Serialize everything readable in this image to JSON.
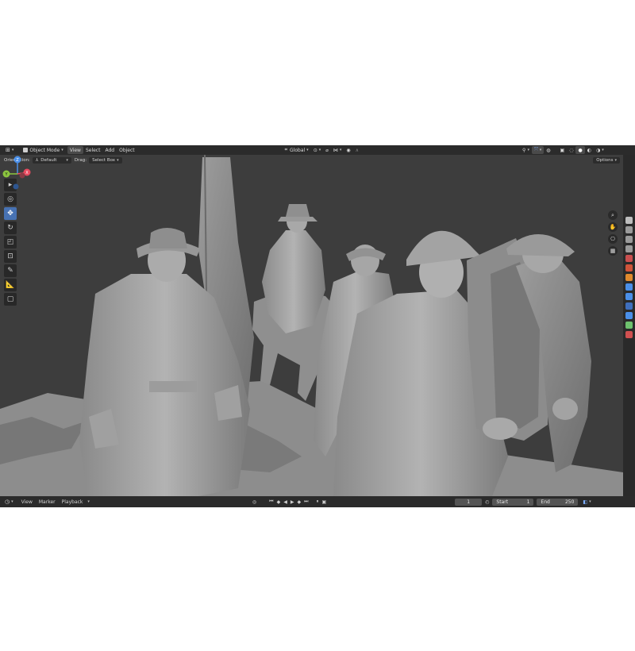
{
  "header": {
    "mode": "Object Mode",
    "menus": [
      "View",
      "Select",
      "Add",
      "Object"
    ],
    "orientation_global": "Global"
  },
  "toolsettings": {
    "orientation_label": "Orientation:",
    "orientation_value": "Default",
    "drag_label": "Drag:",
    "drag_value": "Select Box",
    "options": "Options"
  },
  "toolbar": {
    "tools": [
      "select-box-icon",
      "cursor-icon",
      "move-icon",
      "rotate-icon",
      "scale-icon",
      "transform-icon",
      "annotate-icon",
      "measure-icon",
      "add-cube-icon"
    ],
    "active": "move-icon"
  },
  "gizmo": {
    "axes": [
      "X",
      "Y",
      "Z"
    ],
    "colors": {
      "x": "#e84a5f",
      "y": "#8cc63f",
      "z": "#4a8fe8"
    }
  },
  "timeline": {
    "menus": [
      "View",
      "Marker",
      "Playback"
    ],
    "current_frame": "1",
    "start_label": "Start",
    "start_value": "1",
    "end_label": "End",
    "end_value": "250"
  },
  "colors": {
    "accent": "#4772b3",
    "viewport_bg": "#3d3d3d",
    "header_bg": "#2b2b2b"
  }
}
